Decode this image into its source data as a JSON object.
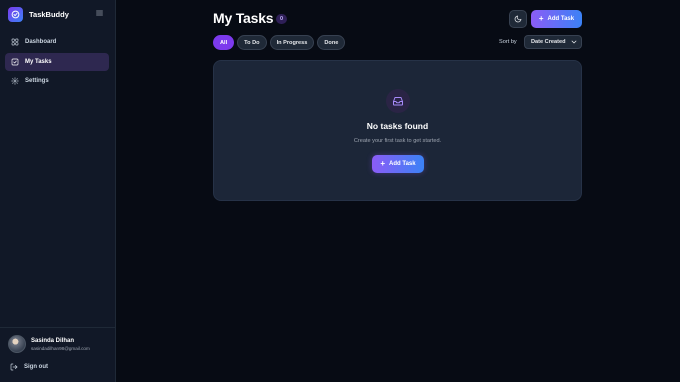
{
  "app": {
    "name": "TaskBuddy",
    "logo_icon": "check-circle-icon",
    "menu_icon": "hamburger-icon"
  },
  "sidebar": {
    "items": [
      {
        "label": "Dashboard",
        "icon": "grid-icon",
        "active": false
      },
      {
        "label": "My Tasks",
        "icon": "checkbox-icon",
        "active": true
      },
      {
        "label": "Settings",
        "icon": "gear-icon",
        "active": false
      }
    ],
    "user": {
      "name": "Sasinda Dilhan",
      "email": "sasindadilhan98@gmail.com"
    },
    "signout_label": "Sign out"
  },
  "header": {
    "title": "My Tasks",
    "task_count": "0",
    "theme_toggle_icon": "moon-icon",
    "add_task_label": "Add Task"
  },
  "filters": {
    "tabs": [
      {
        "label": "All",
        "active": true
      },
      {
        "label": "To Do",
        "active": false
      },
      {
        "label": "In Progress",
        "active": false
      },
      {
        "label": "Done",
        "active": false
      }
    ],
    "sort_label": "Sort by",
    "sort_value": "Date Created"
  },
  "empty_state": {
    "icon": "inbox-icon",
    "title": "No tasks found",
    "subtitle": "Create your first task to get started.",
    "button_label": "Add Task"
  },
  "colors": {
    "accent": "#7c3aed",
    "accent_gradient_end": "#3b82f6",
    "background": "#070b14",
    "sidebar": "#111827",
    "card": "#1c2638"
  }
}
